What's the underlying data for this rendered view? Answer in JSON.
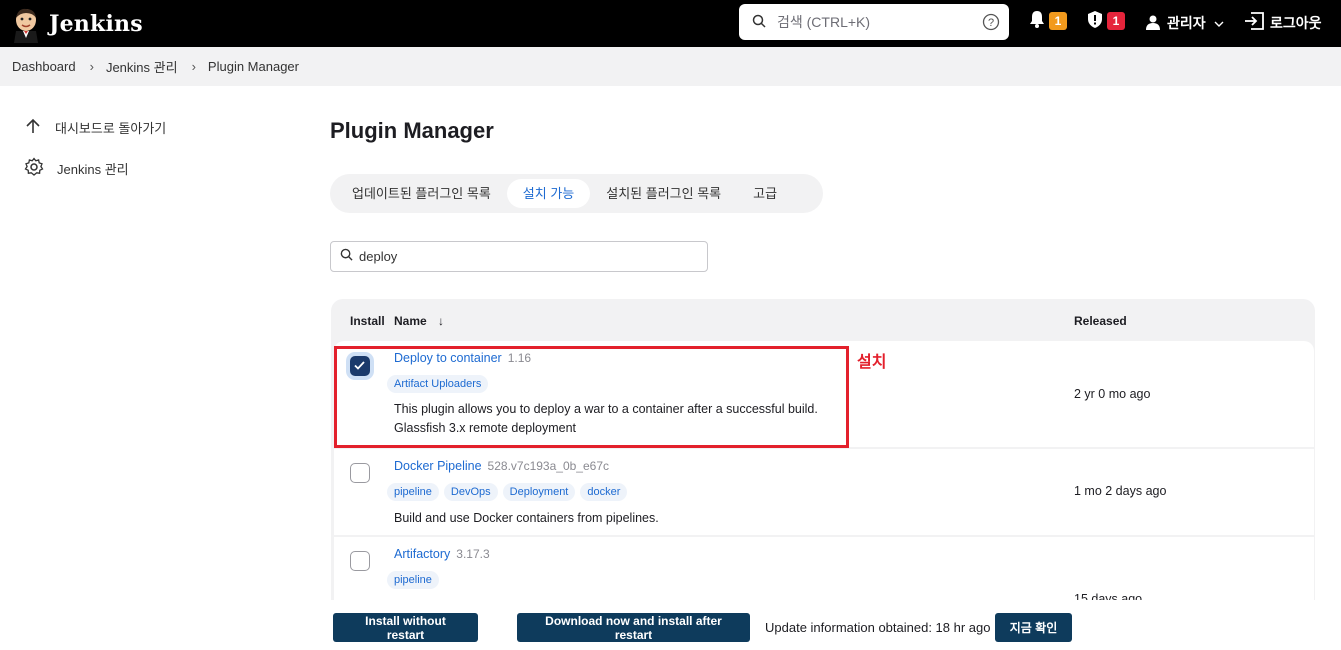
{
  "header": {
    "logo_text": "Jenkins",
    "search_placeholder": "검색 (CTRL+K)",
    "notifications_count": "1",
    "security_count": "1",
    "user_label": "관리자",
    "logout_label": "로그아웃"
  },
  "breadcrumb": [
    "Dashboard",
    "Jenkins 관리",
    "Plugin Manager"
  ],
  "sidebar": {
    "items": [
      {
        "label": "대시보드로 돌아가기",
        "icon": "arrow-up-icon"
      },
      {
        "label": "Jenkins 관리",
        "icon": "gear-icon"
      }
    ]
  },
  "main": {
    "title": "Plugin Manager",
    "tabs": [
      {
        "label": "업데이트된 플러그인 목록",
        "active": false
      },
      {
        "label": "설치 가능",
        "active": true
      },
      {
        "label": "설치된 플러그인 목록",
        "active": false
      },
      {
        "label": "고급",
        "active": false
      }
    ],
    "filter_value": "deploy",
    "table": {
      "headers": {
        "install": "Install",
        "name": "Name",
        "sort_arrow": "↓",
        "released": "Released"
      },
      "rows": [
        {
          "name": "Deploy to container",
          "version": "1.16",
          "tags": [
            "Artifact Uploaders"
          ],
          "description_line1": "This plugin allows you to deploy a war to a container after a successful build.",
          "description_line2": "Glassfish 3.x remote deployment",
          "released": "2 yr 0 mo ago",
          "checked": true
        },
        {
          "name": "Docker Pipeline",
          "version": "528.v7c193a_0b_e67c",
          "tags": [
            "pipeline",
            "DevOps",
            "Deployment",
            "docker"
          ],
          "description_line1": "Build and use Docker containers from pipelines.",
          "released": "1 mo 2 days ago",
          "checked": false
        },
        {
          "name": "Artifactory",
          "version": "3.17.3",
          "tags": [
            "pipeline"
          ],
          "released": "15 days ago",
          "checked": false
        }
      ]
    },
    "annotation": "설치"
  },
  "bottom": {
    "install_without_restart": "Install without restart",
    "download_and_install": "Download now and install after restart",
    "update_info": "Update information obtained: 18 hr ago",
    "check_now": "지금 확인"
  },
  "colors": {
    "accent": "#1d6ad1",
    "primary_button": "#0e3b5c",
    "highlight": "#e3202c",
    "header_bg": "#000000"
  }
}
